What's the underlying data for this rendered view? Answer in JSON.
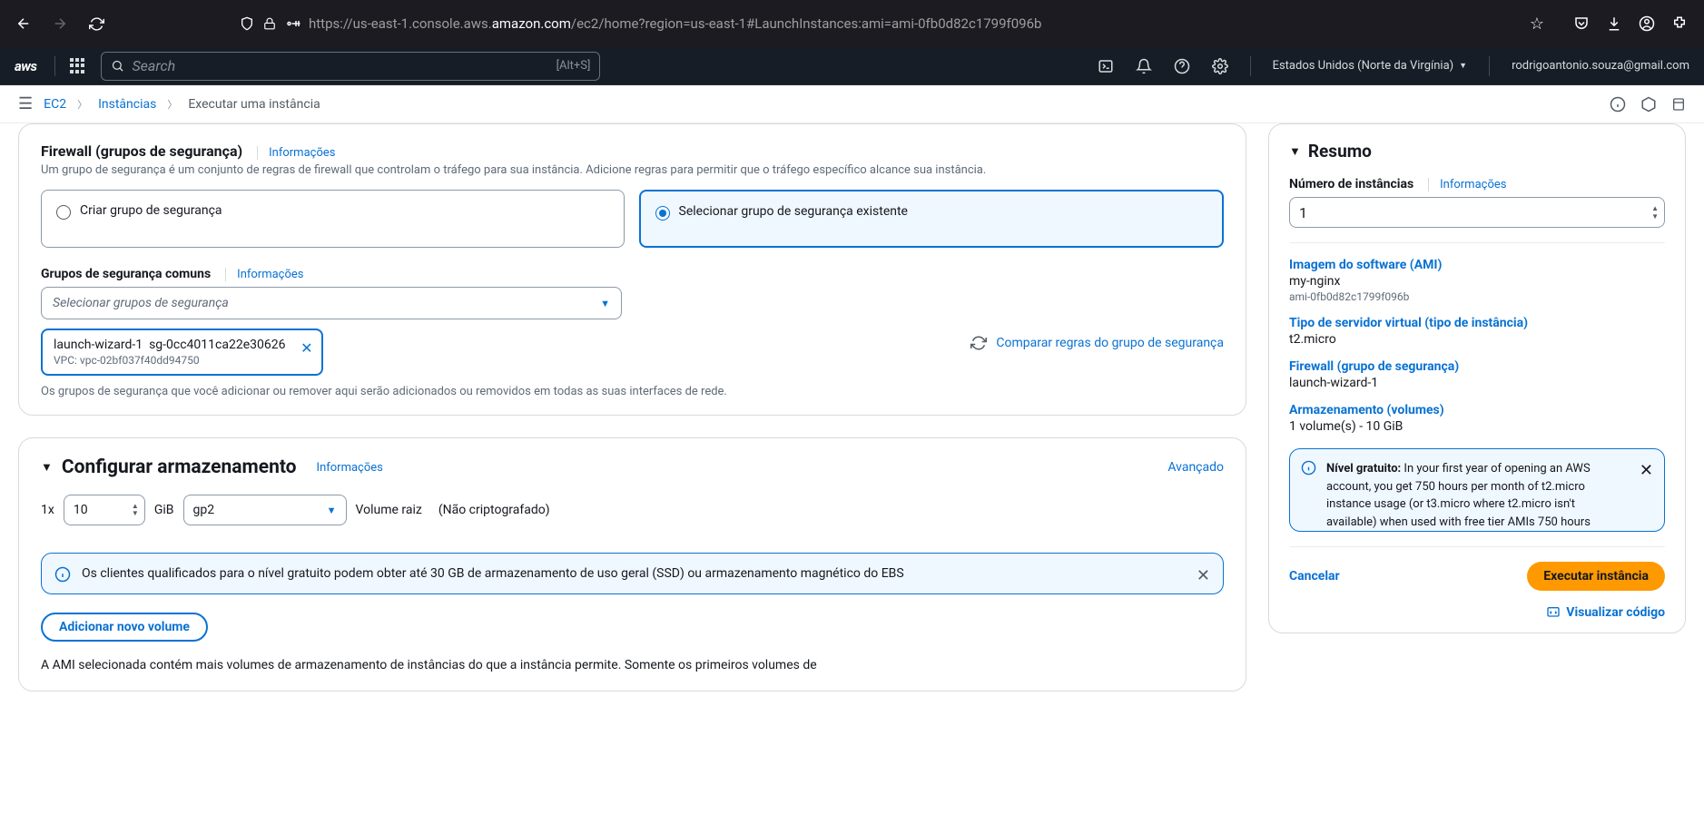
{
  "browser": {
    "url_prefix": "https://us-east-1.console.aws.",
    "url_domain": "amazon.com",
    "url_path": "/ec2/home?region=us-east-1#LaunchInstances:ami=ami-0fb0d82c1799f096b"
  },
  "aws": {
    "logo": "aws",
    "search_placeholder": "Search",
    "search_hint": "[Alt+S]",
    "region": "Estados Unidos (Norte da Virgínia)",
    "user": "rodrigoantonio.souza@gmail.com"
  },
  "breadcrumb": {
    "ec2": "EC2",
    "instances": "Instâncias",
    "current": "Executar uma instância"
  },
  "firewall": {
    "title": "Firewall (grupos de segurança)",
    "info": "Informações",
    "desc": "Um grupo de segurança é um conjunto de regras de firewall que controlam o tráfego para sua instância. Adicione regras para permitir que o tráfego específico alcance sua instância.",
    "opt_create": "Criar grupo de segurança",
    "opt_select": "Selecionar grupo de segurança existente",
    "common_label": "Grupos de segurança comuns",
    "common_info": "Informações",
    "select_placeholder": "Selecionar grupos de segurança",
    "tag_name": "launch-wizard-1",
    "tag_id": "sg-0cc4011ca22e30626",
    "tag_vpc": "VPC: vpc-02bf037f40dd94750",
    "note": "Os grupos de segurança que você adicionar ou remover aqui serão adicionados ou removidos em todas as suas interfaces de rede.",
    "compare": "Comparar regras do grupo de segurança"
  },
  "storage": {
    "title": "Configurar armazenamento",
    "info": "Informações",
    "advanced": "Avançado",
    "qty_prefix": "1x",
    "size": "10",
    "unit": "GiB",
    "type": "gp2",
    "vol_label": "Volume raiz",
    "encrypted": "(Não criptografado)",
    "banner": "Os clientes qualificados para o nível gratuito podem obter até 30 GB de armazenamento de uso geral (SSD) ou armazenamento magnético do EBS",
    "add_volume": "Adicionar novo volume",
    "ami_note": "A AMI selecionada contém mais volumes de armazenamento de instâncias do que a instância permite. Somente os primeiros volumes de"
  },
  "summary": {
    "title": "Resumo",
    "num_label": "Número de instâncias",
    "num_info": "Informações",
    "num_value": "1",
    "ami_label": "Imagem do software (AMI)",
    "ami_name": "my-nginx",
    "ami_id": "ami-0fb0d82c1799f096b",
    "type_label": "Tipo de servidor virtual (tipo de instância)",
    "type_val": "t2.micro",
    "fw_label": "Firewall (grupo de segurança)",
    "fw_val": "launch-wizard-1",
    "store_label": "Armazenamento (volumes)",
    "store_val": "1 volume(s) - 10 GiB",
    "free_title": "Nível gratuito:",
    "free_text": " In your first year of opening an AWS account, you get 750 hours per month of t2.micro instance usage (or t3.micro where t2.micro isn't available) when used with free tier AMIs  750 hours",
    "cancel": "Cancelar",
    "launch": "Executar instância",
    "view_code": "Visualizar código"
  }
}
